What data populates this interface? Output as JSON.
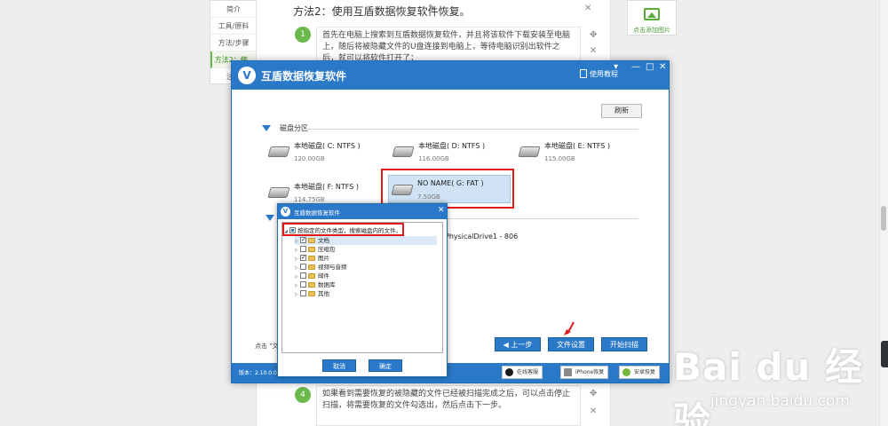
{
  "page": {
    "method_title": "方法2：使用互盾数据恢复软件恢复。",
    "left_nav": [
      "简介",
      "工具/原料",
      "方法/步骤",
      "方法2：使...",
      "注意"
    ],
    "right_panel_label": "点击添加图片",
    "step1_num": "1",
    "step1_text": "首先在电脑上搜索到互盾数据恢复软件，并且将该软件下载安装至电脑上，随后将被隐藏文件的U盘连接到电脑上，等待电脑识别出软件之后，就可以将软件打开了；",
    "step4_num": "4",
    "step4_text": "如果看到需要恢复的被隐藏的文件已经被扫描完成之后，可以点击停止扫描，将需要恢复的文件勾选出，然后点击下一步。"
  },
  "app": {
    "title": "互盾数据恢复软件",
    "help_link": "使用教程",
    "refresh_label": "刷新",
    "disk_section_title": "磁盘分区",
    "disks": [
      {
        "name": "本地磁盘( C: NTFS )",
        "size": "120.00GB"
      },
      {
        "name": "本地磁盘( D: NTFS )",
        "size": "116.00GB"
      },
      {
        "name": "本地磁盘( E: NTFS )",
        "size": "115.00GB"
      },
      {
        "name": "本地磁盘( F: NTFS )",
        "size": "114.75GB"
      },
      {
        "name": "NO NAME( G: FAT )",
        "size": "7.50GB"
      }
    ],
    "physical_disk": "PhysicalDrive1 - 806",
    "hint_text": "点击 \"文",
    "buttons": {
      "prev": "上一步",
      "settings": "文件设置",
      "start": "开始扫描"
    },
    "version": "版本：2.10.0.0",
    "footer_buttons": [
      "在线客服",
      "iPhone恢复",
      "安卓恢复"
    ],
    "window_controls": [
      "▾",
      "—",
      "□",
      "✕"
    ]
  },
  "dialog": {
    "title": "互盾数据恢复软件",
    "close": "✕",
    "root_label": "按指定的文件类型，搜索磁盘内的文件。",
    "items": [
      {
        "label": "文档",
        "checked": true
      },
      {
        "label": "压缩包",
        "checked": false
      },
      {
        "label": "图片",
        "checked": true
      },
      {
        "label": "视频与音频",
        "checked": false
      },
      {
        "label": "邮件",
        "checked": false
      },
      {
        "label": "数据库",
        "checked": false
      },
      {
        "label": "其他",
        "checked": false
      }
    ],
    "cancel_label": "取消",
    "ok_label": "确定"
  },
  "watermark": {
    "logo_text": "Bai du 经验",
    "url": "jingyan.baidu.com"
  },
  "colors": {
    "accent": "#2a79c8",
    "highlight_red": "#e01919",
    "step_green": "#6bb84b"
  }
}
